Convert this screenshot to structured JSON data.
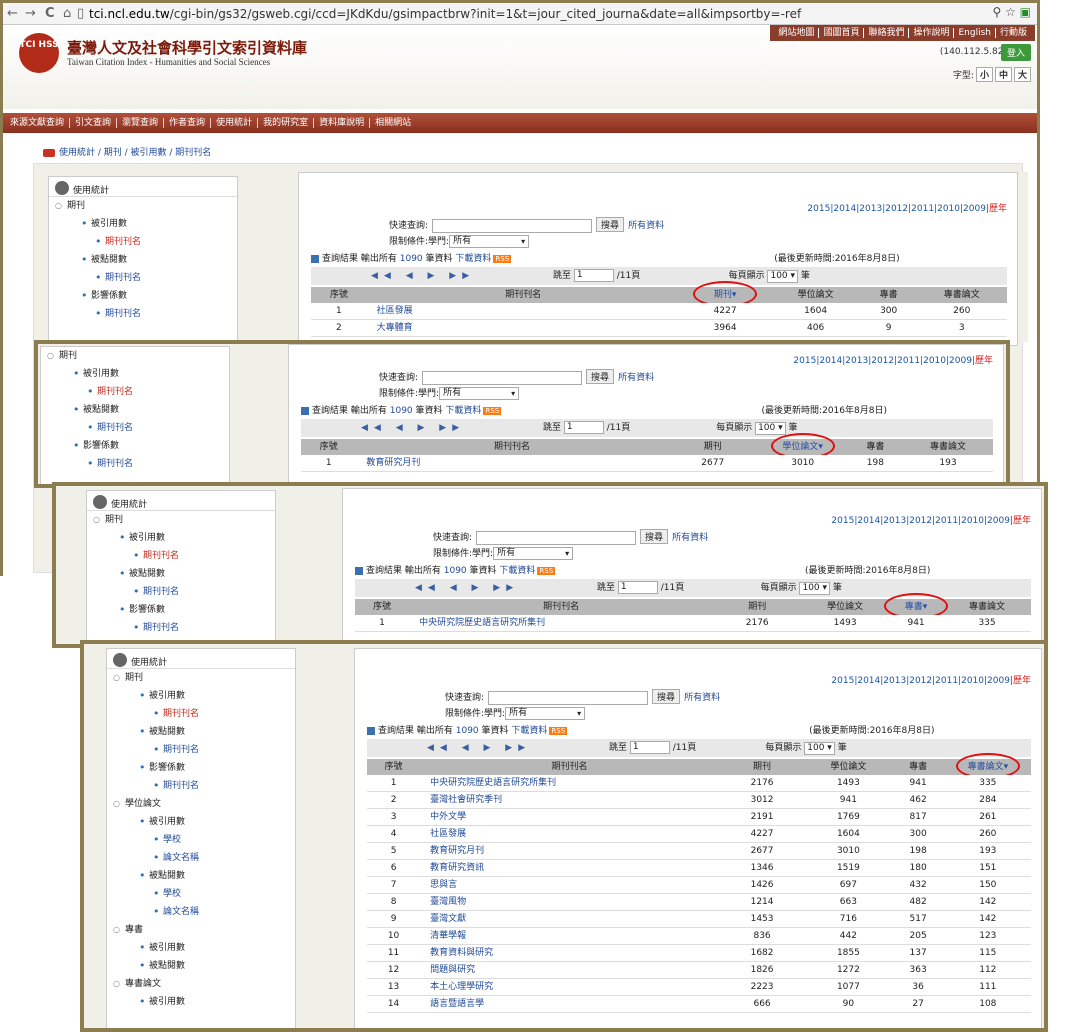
{
  "browser": {
    "url_prefix": "tci.ncl.edu.tw",
    "url_rest": "/cgi-bin/gs32/gsweb.cgi/ccd=JKdKdu/gsimpactbrw?init=1&t=jour_cited_journa&date=all&impsortby=-ref",
    "back": "←",
    "forward": "→",
    "reload": "C",
    "home": "⌂",
    "page_icon": "▯",
    "zoom": "⚲",
    "star": "☆",
    "ext": "▣"
  },
  "site": {
    "logo_text": "TCI HSS",
    "title_zh": "臺灣人文及社會科學引文索引資料庫",
    "title_en": "Taiwan Citation Index - Humanities and Social Sciences",
    "top_links": [
      "網站地圖",
      "國圖首頁",
      "聯絡我們",
      "操作說明",
      "English",
      "行動版"
    ],
    "ip": "(140.112.5.82)",
    "login": "登入",
    "font_label": "字型:",
    "font_small": "小",
    "font_mid": "中",
    "font_big": "大",
    "menu": [
      "來源文獻查詢",
      "引文查詢",
      "瀏覽查詢",
      "作者查詢",
      "使用統計",
      "我的研究室",
      "資料庫說明",
      "相關網站"
    ],
    "breadcrumb": "使用統計 / 期刊 / 被引用數 / 期刊刊名"
  },
  "sidebar": {
    "head": "使用統計",
    "items": [
      {
        "t": "期刊",
        "lv": 0,
        "c": ""
      },
      {
        "t": "被引用數",
        "lv": 1,
        "c": ""
      },
      {
        "t": "期刊刊名",
        "lv": 2,
        "c": "red"
      },
      {
        "t": "被點閱數",
        "lv": 1,
        "c": ""
      },
      {
        "t": "期刊刊名",
        "lv": 2,
        "c": "blue"
      },
      {
        "t": "影響係數",
        "lv": 1,
        "c": ""
      },
      {
        "t": "期刊刊名",
        "lv": 2,
        "c": "blue"
      },
      {
        "t": "學位論文",
        "lv": 0,
        "c": ""
      },
      {
        "t": "被引用數",
        "lv": 1,
        "c": ""
      },
      {
        "t": "學校",
        "lv": 2,
        "c": "blue"
      },
      {
        "t": "論文名稱",
        "lv": 2,
        "c": "blue"
      },
      {
        "t": "被點閱數",
        "lv": 1,
        "c": ""
      },
      {
        "t": "學校",
        "lv": 2,
        "c": "blue"
      },
      {
        "t": "論文名稱",
        "lv": 2,
        "c": "blue"
      },
      {
        "t": "專書",
        "lv": 0,
        "c": ""
      },
      {
        "t": "被引用數",
        "lv": 1,
        "c": ""
      },
      {
        "t": "被點閱數",
        "lv": 1,
        "c": ""
      },
      {
        "t": "專書論文",
        "lv": 0,
        "c": ""
      },
      {
        "t": "被引用數",
        "lv": 1,
        "c": ""
      }
    ]
  },
  "years": {
    "list": "2015|2014|2013|2012|2011|2010|2009|",
    "current": "歷年"
  },
  "search": {
    "label": "快速查詢:",
    "button": "搜尋",
    "all": "所有資料",
    "limit_label": "限制條件:學門:",
    "limit_value": "所有"
  },
  "results": {
    "label": "查詢結果",
    "output_pre": "輸出所有",
    "count": "1090",
    "output_post": "筆資料",
    "download": "下載資料",
    "rss": "RSS",
    "updated": "(最後更新時間:2016年8月8日)"
  },
  "pager": {
    "arrows": "◀◀ ◀ ▶ ▶▶",
    "jump": "跳至",
    "page": "1",
    "total": "/11頁",
    "per_page": "每頁顯示",
    "per_value": "100",
    "unit": "筆"
  },
  "columns": [
    "序號",
    "期刊刊名",
    "期刊",
    "學位論文",
    "專書",
    "專書論文"
  ],
  "sort_arrow": "▾",
  "panels": [
    {
      "sort_col": 2,
      "rows": [
        [
          "1",
          "社區發展",
          "4227",
          "1604",
          "300",
          "260"
        ],
        [
          "2",
          "大專體育",
          "3964",
          "406",
          "9",
          "3"
        ]
      ]
    },
    {
      "sort_col": 3,
      "rows": [
        [
          "1",
          "教育研究月刊",
          "2677",
          "3010",
          "198",
          "193"
        ]
      ]
    },
    {
      "sort_col": 4,
      "rows": [
        [
          "1",
          "中央研究院歷史語言研究所集刊",
          "2176",
          "1493",
          "941",
          "335"
        ]
      ]
    },
    {
      "sort_col": 5,
      "rows": [
        [
          "1",
          "中央研究院歷史語言研究所集刊",
          "2176",
          "1493",
          "941",
          "335"
        ],
        [
          "2",
          "臺灣社會研究季刊",
          "3012",
          "941",
          "462",
          "284"
        ],
        [
          "3",
          "中外文學",
          "2191",
          "1769",
          "817",
          "261"
        ],
        [
          "4",
          "社區發展",
          "4227",
          "1604",
          "300",
          "260"
        ],
        [
          "5",
          "教育研究月刊",
          "2677",
          "3010",
          "198",
          "193"
        ],
        [
          "6",
          "教育研究資訊",
          "1346",
          "1519",
          "180",
          "151"
        ],
        [
          "7",
          "思與言",
          "1426",
          "697",
          "432",
          "150"
        ],
        [
          "8",
          "臺灣風物",
          "1214",
          "663",
          "482",
          "142"
        ],
        [
          "9",
          "臺灣文獻",
          "1453",
          "716",
          "517",
          "142"
        ],
        [
          "10",
          "清華學報",
          "836",
          "442",
          "205",
          "123"
        ],
        [
          "11",
          "教育資料與研究",
          "1682",
          "1855",
          "137",
          "115"
        ],
        [
          "12",
          "問題與研究",
          "1826",
          "1272",
          "363",
          "112"
        ],
        [
          "13",
          "本土心理學研究",
          "2223",
          "1077",
          "36",
          "111"
        ],
        [
          "14",
          "語言暨語言學",
          "666",
          "90",
          "27",
          "108"
        ]
      ]
    }
  ]
}
